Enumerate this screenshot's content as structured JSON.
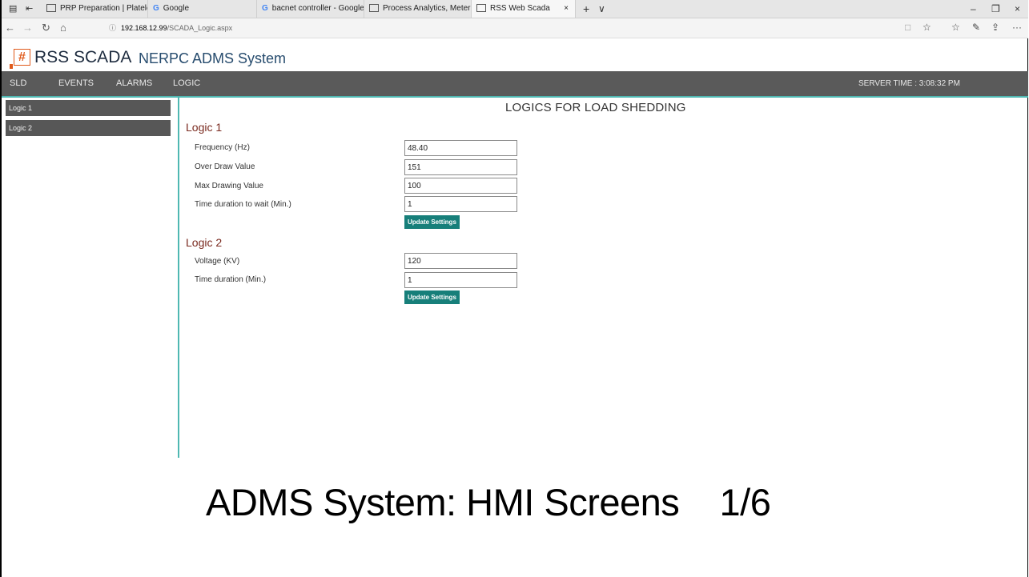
{
  "browser": {
    "tabs": [
      {
        "label": "PRP Preparation | Platelet R",
        "icon": "page"
      },
      {
        "label": "Google",
        "icon": "google"
      },
      {
        "label": "bacnet controller - Google S",
        "icon": "google"
      },
      {
        "label": "Process Analytics, Metering",
        "icon": "page"
      },
      {
        "label": "RSS Web Scada",
        "icon": "page",
        "active": true
      }
    ],
    "close_tab": "×",
    "new_tab": "+",
    "tab_menu": "∨",
    "url_host": "192.168.12.99",
    "url_path": "/SCADA_Logic.aspx",
    "nav": {
      "back": "←",
      "forward": "→",
      "refresh": "↻",
      "home": "⌂",
      "info": "ⓘ"
    },
    "tools": {
      "reading": "□",
      "favorite": "☆",
      "favorites": "☆",
      "notes": "✎",
      "share": "⇪",
      "more": "···"
    },
    "window": {
      "minimize": "–",
      "restore": "❐",
      "close": "×"
    }
  },
  "app": {
    "logo_glyph": "#",
    "brand": "RSS SCADA",
    "system_name": "NERPC ADMS System"
  },
  "nav": {
    "items": [
      "SLD",
      "EVENTS",
      "ALARMS",
      "LOGIC"
    ],
    "server_time": "SERVER TIME : 3:08:32 PM"
  },
  "sidebar": {
    "items": [
      "Logic 1",
      "Logic 2"
    ]
  },
  "main": {
    "title": "LOGICS FOR LOAD SHEDDING",
    "logic1": {
      "heading": "Logic 1",
      "fields": [
        {
          "label": "Frequency (Hz)",
          "value": "48.40"
        },
        {
          "label": "Over Draw Value",
          "value": "151"
        },
        {
          "label": "Max Drawing Value",
          "value": "100"
        },
        {
          "label": "Time duration to wait (Min.)",
          "value": "1"
        }
      ],
      "button": "Update Settings"
    },
    "logic2": {
      "heading": "Logic 2",
      "fields": [
        {
          "label": "Voltage (KV)",
          "value": "120"
        },
        {
          "label": "Time duration (Min.)",
          "value": "1"
        }
      ],
      "button": "Update Settings"
    }
  },
  "caption": "ADMS System: HMI Screens    1/6",
  "colors": {
    "nav_bg": "#5a5a5a",
    "accent_teal": "#4fb8b2",
    "button_teal": "#177f7a",
    "logo_orange": "#e05a1b",
    "heading_red": "#7a2a1f"
  }
}
